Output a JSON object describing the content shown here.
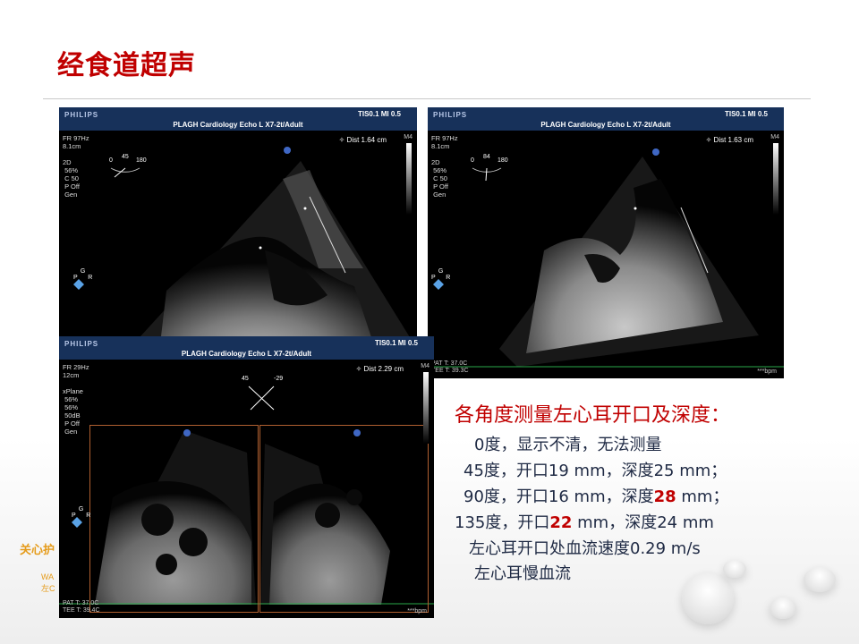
{
  "slide": {
    "title": "经食道超声"
  },
  "echo_panels": [
    {
      "brand": "PHILIPS",
      "tis_mi": "TIS0.1   MI 0.5",
      "center_label": "PLAGH Cardiology Echo L  X7-2t/Adult",
      "settings": "FR 97Hz\n8.1cm\n\n2D\n 56%\n C 50\n P Off\n Gen",
      "dist": "✧ Dist   1.64 cm",
      "m4": "M4",
      "angle": "45",
      "angle_max": "180",
      "angle_min": "0",
      "orient": "G\nP      R"
    },
    {
      "brand": "PHILIPS",
      "tis_mi": "TIS0.1   MI 0.5",
      "center_label": "PLAGH Cardiology Echo L  X7-2t/Adult",
      "settings": "FR 97Hz\n8.1cm\n\n2D\n 56%\n C 50\n P Off\n Gen",
      "dist": "✧ Dist   1.63 cm",
      "m4": "M4",
      "angle": "84",
      "angle_max": "180",
      "angle_min": "0",
      "orient": "G\nP      R",
      "pat_temp": "PAT T: 37.0C",
      "tee_temp": "TEE T: 39.3C",
      "bpm": "***bpm"
    },
    {
      "brand": "PHILIPS",
      "tis_mi": "TIS0.1   MI 0.5",
      "center_label": "PLAGH Cardiology Echo L  X7-2t/Adult",
      "settings": "FR 29Hz\n12cm\n\nxPlane\n 56%\n 56%\n 50dB\n P Off\n Gen",
      "dist": "✧ Dist   2.29 cm",
      "m4": "M4",
      "angle_left": "45",
      "angle_right": "-29",
      "orient": "G\nP      R",
      "pat_temp": "PAT T: 37.0C",
      "tee_temp": "TEE T: 39.4C",
      "bpm": "***bpm"
    }
  ],
  "background_text": {
    "line1": "关心护",
    "line2": "WA",
    "line3": "左C"
  },
  "notes": {
    "heading": "各角度测量左心耳开口及深度：",
    "line1": "0度，显示不清，无法测量",
    "line2": "45度，开口19 mm，深度25 mm；",
    "line3_pre": "90度，开口16 mm，深度",
    "line3_red": "28",
    "line3_post": " mm；",
    "line4_pre": "135度，开口",
    "line4_red": "22",
    "line4_post": " mm，深度24 mm",
    "line5": "左心耳开口处血流速度0.29 m/s",
    "line6": "左心耳慢血流"
  },
  "colors": {
    "title_red": "#c00000",
    "text_navy": "#1f2a44",
    "echo_header": "#17315a",
    "ecg_green": "#2aa84a"
  }
}
